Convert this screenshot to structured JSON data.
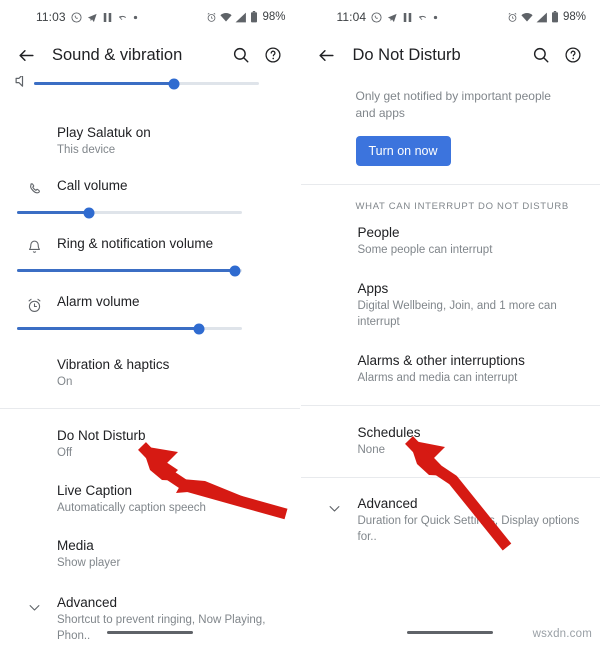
{
  "left": {
    "status_bar": {
      "time": "11:03",
      "left_icons": [
        "whatsapp-icon",
        "telegram-icon",
        "pause-icon",
        "missed-call-icon",
        "dot-icon"
      ],
      "right_icons": [
        "alarm-icon",
        "wifi-icon",
        "signal-icon",
        "battery-icon"
      ],
      "battery": "98%"
    },
    "appbar": {
      "back": "back-arrow",
      "title": "Sound & vibration",
      "search": "search-icon",
      "help": "help-icon"
    },
    "sliders": [
      {
        "name": "media-volume",
        "label": "",
        "value": 62,
        "icon": "media-icon",
        "partial": true
      },
      {
        "name": "call-volume",
        "label": "Call volume",
        "value": 32,
        "icon": "call-icon",
        "partial": false
      },
      {
        "name": "ring-notification-volume",
        "label": "Ring & notification volume",
        "value": 97,
        "icon": "bell-icon",
        "partial": false
      },
      {
        "name": "alarm-volume",
        "label": "Alarm volume",
        "value": 81,
        "icon": "alarm-clock-icon",
        "partial": false
      }
    ],
    "items": [
      {
        "title": "Play Salatuk on",
        "sub": "This device"
      },
      {
        "title": "Vibration & haptics",
        "sub": "On"
      },
      {
        "title": "Do Not Disturb",
        "sub": "Off"
      },
      {
        "title": "Live Caption",
        "sub": "Automatically caption speech"
      },
      {
        "title": "Media",
        "sub": "Show player"
      },
      {
        "title": "Advanced",
        "sub": "Shortcut to prevent ringing, Now Playing, Phon.."
      }
    ]
  },
  "right": {
    "status_bar": {
      "time": "11:04",
      "left_icons": [
        "whatsapp-icon",
        "telegram-icon",
        "pause-icon",
        "missed-call-icon",
        "dot-icon"
      ],
      "right_icons": [
        "alarm-icon",
        "wifi-icon",
        "signal-icon",
        "battery-icon"
      ],
      "battery": "98%"
    },
    "appbar": {
      "back": "back-arrow",
      "title": "Do Not Disturb",
      "search": "search-icon",
      "help": "help-icon"
    },
    "description": "Only get notified by important people and apps",
    "turn_on_label": "Turn on now",
    "section_header": "WHAT CAN INTERRUPT DO NOT DISTURB",
    "items": [
      {
        "title": "People",
        "sub": "Some people can interrupt"
      },
      {
        "title": "Apps",
        "sub": "Digital Wellbeing, Join, and 1 more can interrupt"
      },
      {
        "title": "Alarms & other interruptions",
        "sub": "Alarms and media can interrupt"
      },
      {
        "title": "Schedules",
        "sub": "None"
      },
      {
        "title": "Advanced",
        "sub": "Duration for Quick Settings, Display options for.."
      }
    ]
  },
  "annotations": {
    "arrow_color": "#d61a13",
    "arrow_left": "points-to-do-not-disturb",
    "arrow_right": "points-to-schedules"
  },
  "watermark": "wsxdn.com",
  "colors": {
    "accent": "#3c74dd",
    "slider_fill": "#3b6ec4",
    "text_primary": "#202124",
    "text_secondary": "#80868b",
    "divider": "#e8eaed"
  }
}
